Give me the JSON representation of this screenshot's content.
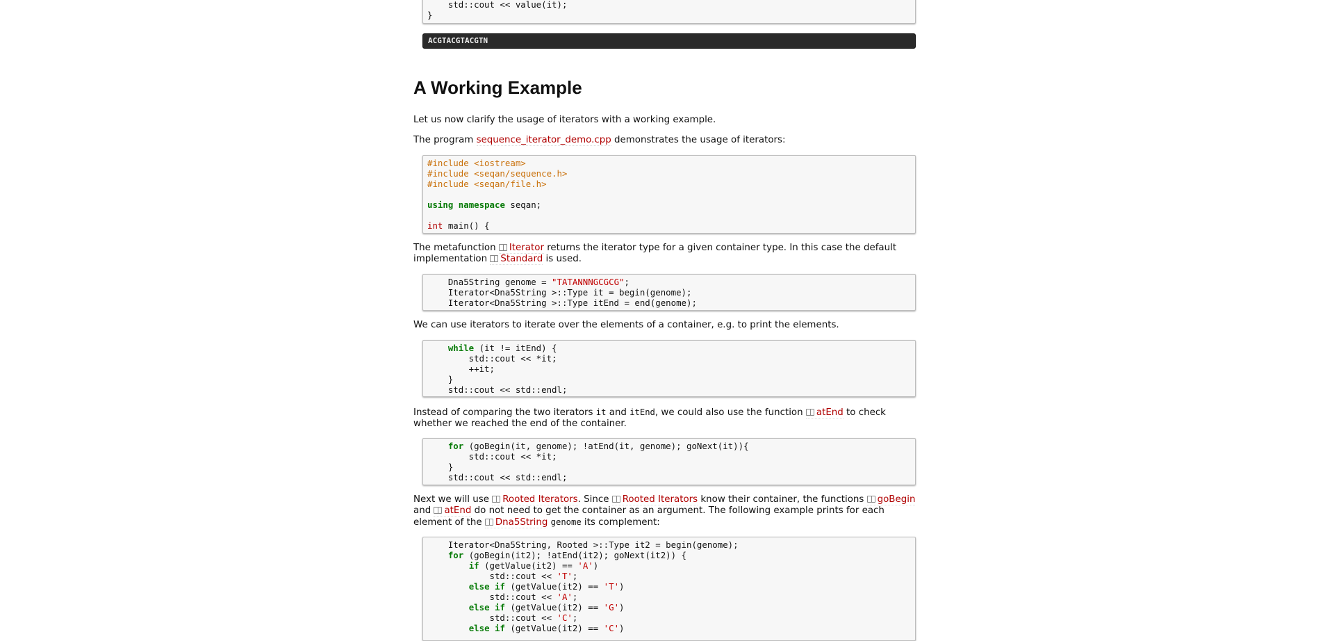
{
  "prev_code": {
    "line1": "    std::cout << value(it);",
    "line2": "}"
  },
  "prev_output": "ACGTACGTACGTN",
  "heading": "A Working Example",
  "intro": "Let us now clarify the usage of iterators with a working example.",
  "program_para": {
    "before": "The program ",
    "link": "sequence_iterator_demo.cpp",
    "after": " demonstrates the usage of iterators:"
  },
  "code1": {
    "inc1": "#include <iostream>",
    "inc2": "#include <seqan/sequence.h>",
    "inc3": "#include <seqan/file.h>",
    "using_kw1": "using",
    "using_kw2": "namespace",
    "using_rest": " seqan;",
    "int_kw": "int",
    "main_rest": " main() {"
  },
  "para_metafunction": {
    "t1": "The metafunction ",
    "link1": "Iterator",
    "t2": " returns the iterator type for a given container type. In this case the default implementation ",
    "link2": "Standard",
    "t3": " is used."
  },
  "code2": {
    "l1a": "    Dna5String genome = ",
    "l1b": "\"TATANNNGCGCG\"",
    "l1c": ";",
    "l2": "    Iterator<Dna5String >::Type it = begin(genome);",
    "l3": "    Iterator<Dna5String >::Type itEnd = end(genome);"
  },
  "para_iterate": "We can use iterators to iterate over the elements of a container, e.g. to print the elements.",
  "code3": {
    "while_kw": "while",
    "l1": " (it != itEnd) {",
    "l2": "        std::cout << *it;",
    "l3": "        ++it;",
    "l4": "    }",
    "l5": "    std::cout << std::endl;"
  },
  "para_atend": {
    "t1": "Instead of comparing the two iterators ",
    "c1": "it",
    "t2": " and ",
    "c2": "itEnd",
    "t3": ", we could also use the function ",
    "link": "atEnd",
    "t4": " to check whether we reached the end of the container."
  },
  "code4": {
    "for_kw": "for",
    "l1": " (goBegin(it, genome); !atEnd(it, genome); goNext(it)){",
    "l2": "        std::cout << *it;",
    "l3": "    }",
    "l4": "    std::cout << std::endl;"
  },
  "para_rooted": {
    "t1": "Next we will use ",
    "link1": "Rooted Iterators",
    "t2": ". Since ",
    "link2": "Rooted Iterators",
    "t3": " know their container, the functions ",
    "link3": "goBegin",
    "t4": " and ",
    "link4": "atEnd",
    "t5": " do not need to get the container as an argument. The following example prints for each element of the ",
    "link5": "Dna5String",
    "t6": " ",
    "c1": "genome",
    "t7": " its complement:"
  },
  "code5": {
    "l1": "    Iterator<Dna5String, Rooted >::Type it2 = begin(genome);",
    "for_kw": "for",
    "l2": " (goBegin(it2); !atEnd(it2); goNext(it2)) {",
    "if_kw": "if",
    "l3a": " (getValue(it2) == ",
    "l3b": "'A'",
    "l3c": ")",
    "l4a": "            std::cout << ",
    "l4b": "'T'",
    "l4c": ";",
    "elseif_kw": "else if",
    "l5a": " (getValue(it2) == ",
    "l5b": "'T'",
    "l5c": ")",
    "l6a": "            std::cout << ",
    "l6b": "'A'",
    "l6c": ";",
    "l7a": " (getValue(it2) == ",
    "l7b": "'G'",
    "l7c": ")",
    "l8a": "            std::cout << ",
    "l8b": "'C'",
    "l8c": ";",
    "l9a": " (getValue(it2) == ",
    "l9b": "'C'",
    "l9c": ")"
  }
}
